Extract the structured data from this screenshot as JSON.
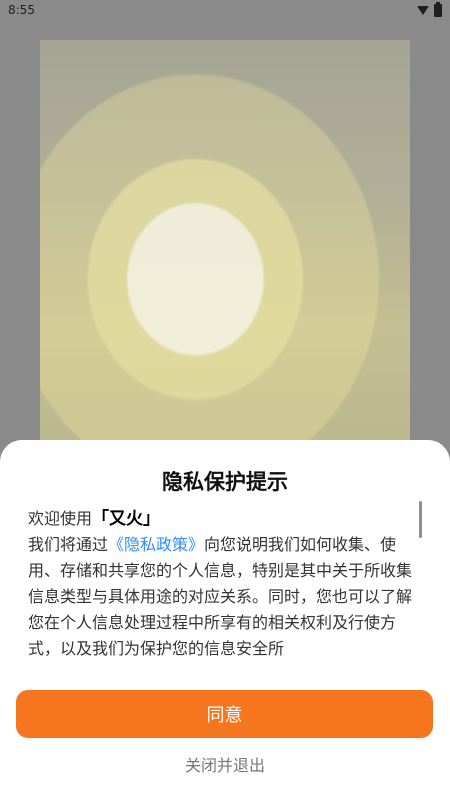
{
  "status_bar": {
    "time": "8:55",
    "icons": [
      "wifi-icon",
      "battery-icon"
    ]
  },
  "dialog": {
    "title": "隐私保护提示",
    "greeting_prefix": "欢迎使用",
    "app_name": "「又火」",
    "intro_before_link": "我们将通过",
    "policy_link": "《隐私政策》",
    "intro_after_link": "向您说明我们如何收集、使用、存储和共享您的个人信息，特别是其中关于所收集信息类型与具体用途的对应关系。同时，您也可以了解您在个人信息处理过程中所享有的相关权利及行使方式，以及我们为保护您的信息安全所",
    "agree_button": "同意",
    "exit_button": "关闭并退出"
  },
  "colors": {
    "accent": "#f6751f",
    "link": "#2f8dfd"
  }
}
